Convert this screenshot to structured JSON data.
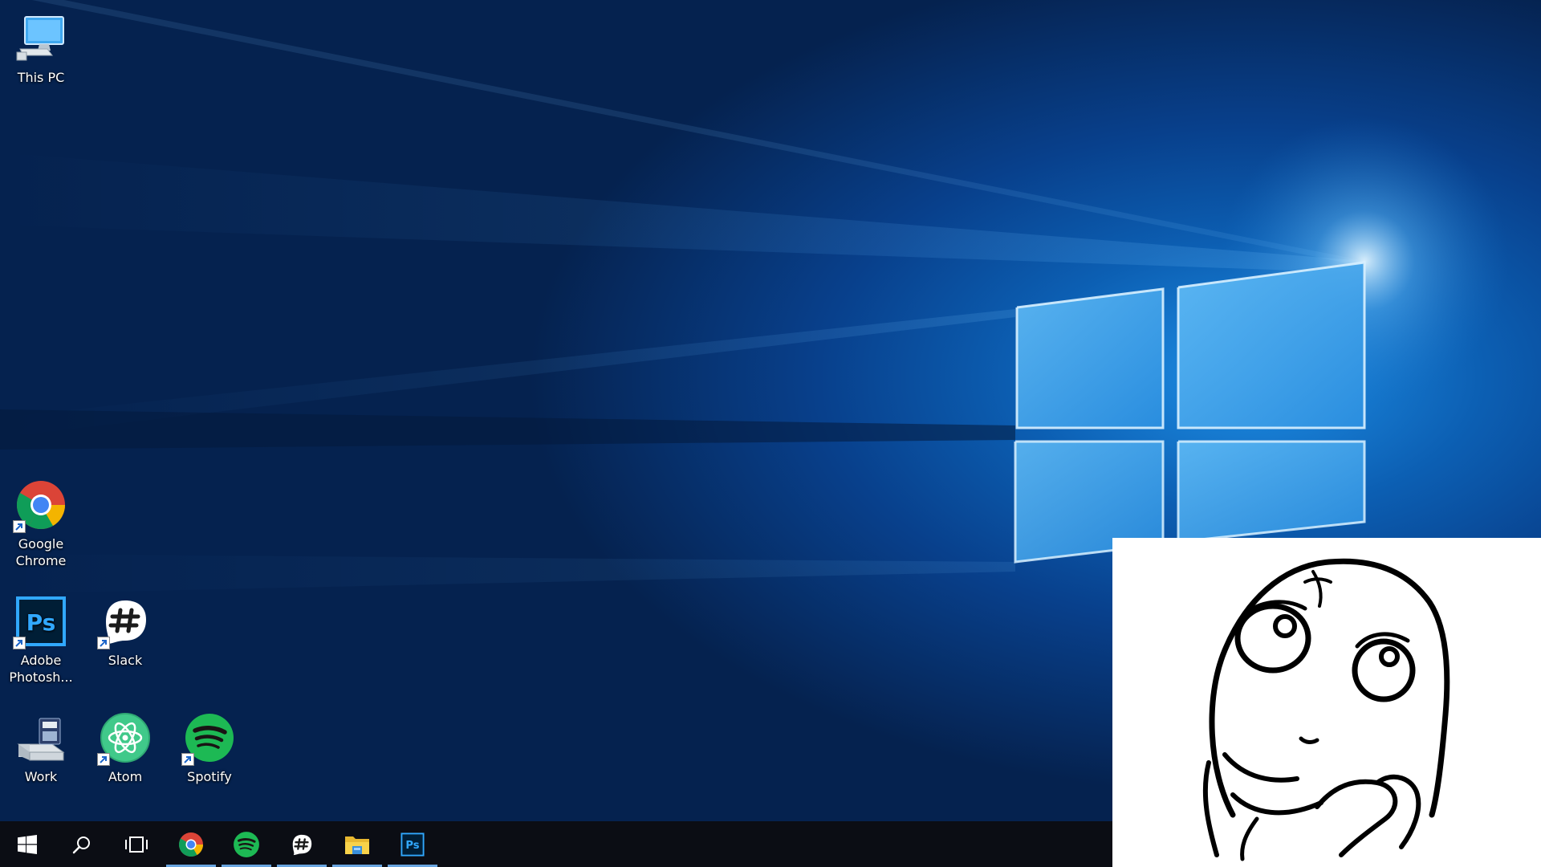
{
  "desktop": {
    "icons": [
      {
        "id": "this-pc",
        "label": "This PC",
        "icon": "computer-icon",
        "shortcut": false
      },
      {
        "id": "google-chrome",
        "label": "Google\nChrome",
        "icon": "chrome-icon",
        "shortcut": true
      },
      {
        "id": "adobe-photoshop",
        "label": "Adobe\nPhotosh...",
        "icon": "photoshop-icon",
        "shortcut": true
      },
      {
        "id": "slack",
        "label": "Slack",
        "icon": "slack-icon",
        "shortcut": true
      },
      {
        "id": "work",
        "label": "Work",
        "icon": "drive-icon",
        "shortcut": false
      },
      {
        "id": "atom",
        "label": "Atom",
        "icon": "atom-icon",
        "shortcut": true
      },
      {
        "id": "spotify",
        "label": "Spotify",
        "icon": "spotify-icon",
        "shortcut": true
      }
    ]
  },
  "taskbar": {
    "buttons": [
      {
        "id": "start",
        "icon": "windows-start-icon",
        "running": false
      },
      {
        "id": "search",
        "icon": "search-icon",
        "running": false
      },
      {
        "id": "task-view",
        "icon": "task-view-icon",
        "running": false
      },
      {
        "id": "chrome",
        "icon": "chrome-icon",
        "running": true
      },
      {
        "id": "spotify",
        "icon": "spotify-icon",
        "running": true
      },
      {
        "id": "slack",
        "icon": "slack-icon",
        "running": true
      },
      {
        "id": "file-explorer",
        "icon": "folder-icon",
        "running": true
      },
      {
        "id": "photoshop",
        "icon": "photoshop-icon",
        "running": true
      }
    ]
  },
  "overlay": {
    "icon": "thinking-face-meme"
  },
  "colors": {
    "accent": "#69a5e0",
    "taskbar": "#0b0d14",
    "spotify": "#1db954",
    "photoshop": "#31a8ff"
  }
}
